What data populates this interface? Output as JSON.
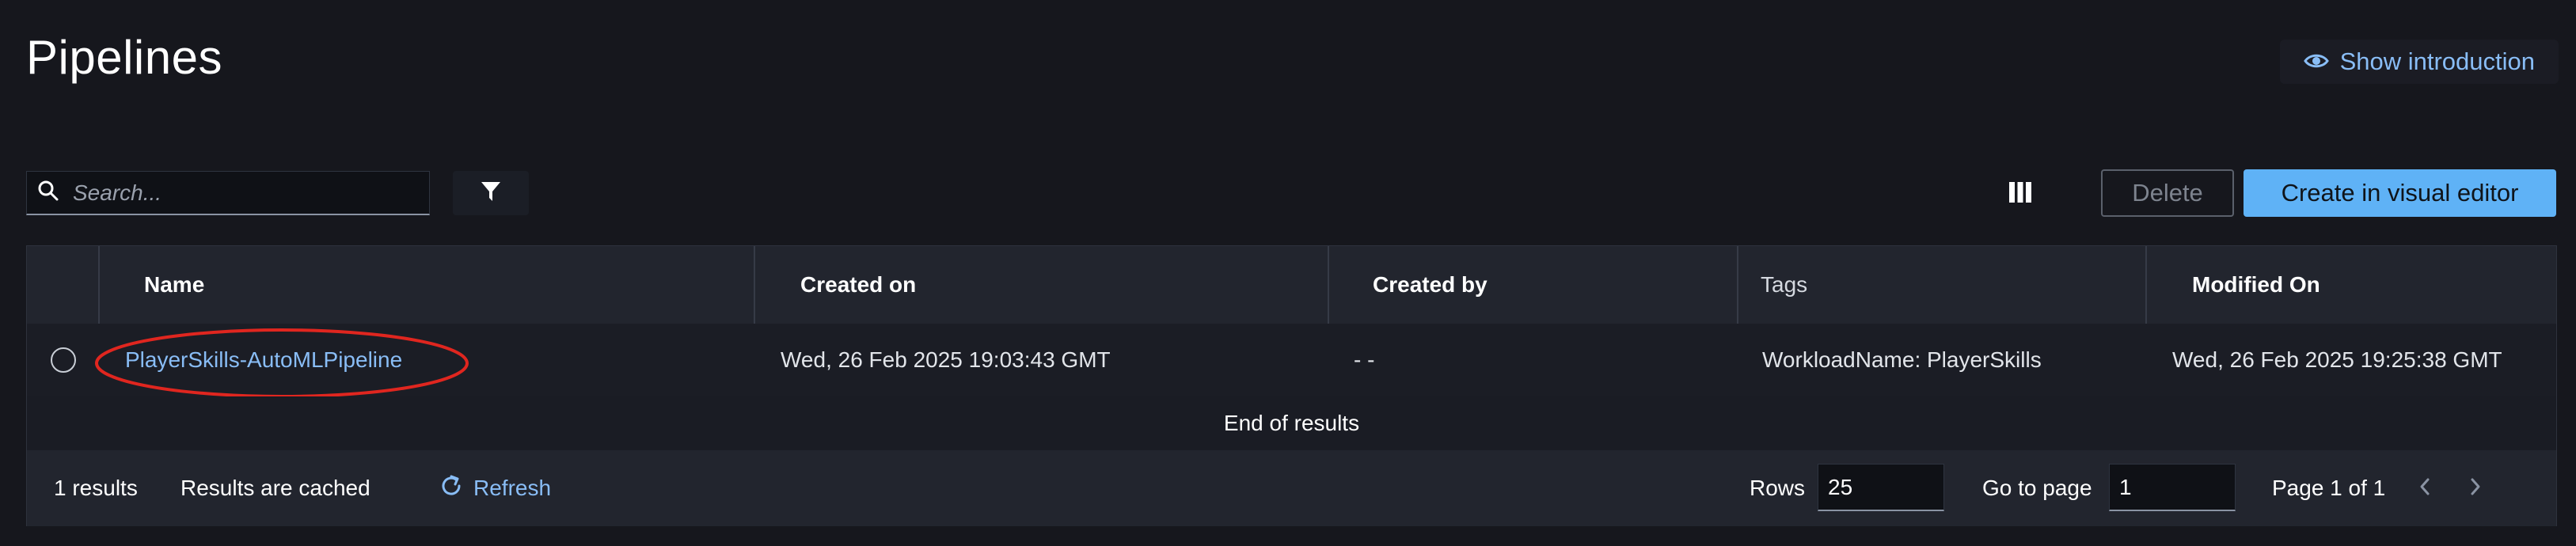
{
  "page": {
    "title": "Pipelines"
  },
  "header": {
    "show_intro_label": "Show introduction",
    "show_intro_icon": "eye-icon"
  },
  "toolbar": {
    "search_placeholder": "Search...",
    "search_value": "",
    "filter_icon": "filter-icon",
    "columns_icon": "columns-icon",
    "delete_label": "Delete",
    "create_label": "Create in visual editor"
  },
  "table": {
    "columns": [
      "Name",
      "Created on",
      "Created by",
      "Tags",
      "Modified On"
    ],
    "rows": [
      {
        "name": "PlayerSkills-AutoMLPipeline",
        "created_on": "Wed, 26 Feb 2025 19:03:43 GMT",
        "created_by": "- -",
        "tags": "WorkloadName: PlayerSkills",
        "modified_on": "Wed, 26 Feb 2025 19:25:38 GMT"
      }
    ],
    "end_text": "End of results"
  },
  "footer": {
    "results_count": "1 results",
    "cache_status": "Results are cached",
    "refresh_label": "Refresh",
    "rows_label": "Rows",
    "rows_value": "25",
    "goto_label": "Go to page",
    "goto_value": "1",
    "page_info": "Page 1 of 1"
  },
  "colors": {
    "background": "#16171d",
    "accent_link": "#89bdf6",
    "primary_button": "#5fb2f6",
    "highlight_ellipse": "#e0261f"
  }
}
